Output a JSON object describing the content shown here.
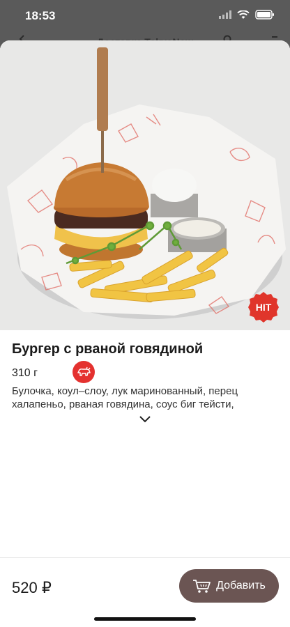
{
  "status": {
    "time": "18:53"
  },
  "underlying_header": {
    "title": "Доставка TokyoNow"
  },
  "product": {
    "badge": "HIT",
    "title": "Бургер с рваной говядиной",
    "weight": "310 г",
    "description": "Булочка, коул–слоу, лук маринованный, перец халапеньо, рваная говядина, соус биг тейсти,",
    "price": "520 ₽"
  },
  "actions": {
    "add_label": "Добавить"
  },
  "colors": {
    "accent": "#e4312f",
    "button": "#6b5553"
  }
}
